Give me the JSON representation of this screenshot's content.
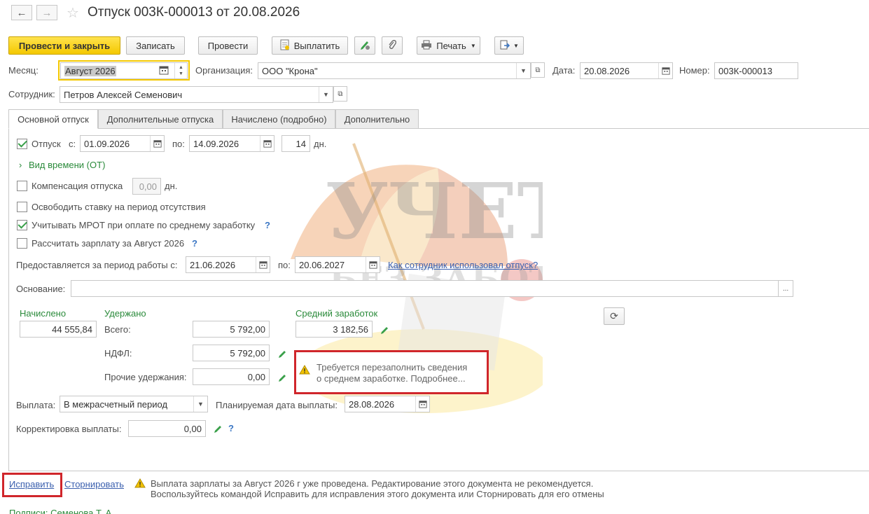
{
  "header": {
    "title": "Отпуск 003К-000013 от 20.08.2026",
    "back_icon": "arrow-left-icon",
    "forward_icon": "arrow-right-icon",
    "favorite_icon": "star-icon"
  },
  "toolbar": {
    "post_close": "Провести и закрыть",
    "save": "Записать",
    "post": "Провести",
    "pay": "Выплатить",
    "print": "Печать"
  },
  "form": {
    "month_label": "Месяц:",
    "month_value": "Август 2026",
    "org_label": "Организация:",
    "org_value": "ООО \"Крона\"",
    "date_label": "Дата:",
    "date_value": "20.08.2026",
    "number_label": "Номер:",
    "number_value": "003К-000013",
    "employee_label": "Сотрудник:",
    "employee_value": "Петров Алексей Семенович"
  },
  "tabs": [
    {
      "label": "Основной отпуск",
      "active": true
    },
    {
      "label": "Дополнительные отпуска",
      "active": false
    },
    {
      "label": "Начислено (подробно)",
      "active": false
    },
    {
      "label": "Дополнительно",
      "active": false
    }
  ],
  "main": {
    "vacation_label": "Отпуск",
    "from_label": "с:",
    "from_value": "01.09.2026",
    "to_label": "по:",
    "to_value": "14.09.2026",
    "days_value": "14",
    "days_unit": "дн.",
    "time_type": "Вид времени (ОТ)",
    "compensation_label": "Компенсация отпуска",
    "compensation_value": "0,00",
    "compensation_unit": "дн.",
    "free_rate_label": "Освободить ставку на период отсутствия",
    "mrot_label": "Учитывать МРОТ при оплате по среднему заработку",
    "calc_salary_label": "Рассчитать зарплату за Август 2026",
    "help_mark": "?",
    "period_label": "Предоставляется за период работы с:",
    "period_from": "21.06.2026",
    "period_to_label": "по:",
    "period_to": "20.06.2027",
    "period_link": "Как сотрудник использовал отпуск?",
    "basis_label": "Основание:",
    "basis_btn": "...",
    "accrued_label": "Начислено",
    "accrued_value": "44 555,84",
    "withheld_label": "Удержано",
    "total_label": "Всего:",
    "total_value": "5 792,00",
    "ndfl_label": "НДФЛ:",
    "ndfl_value": "5 792,00",
    "other_label": "Прочие удержания:",
    "other_value": "0,00",
    "avg_label": "Средний заработок",
    "avg_value": "3 182,56",
    "warning_text_1": "Требуется перезаполнить сведения",
    "warning_text_2": "о среднем заработке. Подробнее...",
    "payout_label": "Выплата:",
    "payout_value": "В межрасчетный период",
    "plan_date_label": "Планируемая дата выплаты:",
    "plan_date_value": "28.08.2026",
    "correction_label": "Корректировка выплаты:",
    "correction_value": "0,00"
  },
  "footer": {
    "fix_link": "Исправить",
    "storno_link": "Сторнировать",
    "message_1": "Выплата зарплаты за Август 2026 г уже проведена. Редактирование этого документа не рекомендуется.",
    "message_2": "Воспользуйтесь командой Исправить для исправления этого документа или Сторнировать для его отмены",
    "signatures": "Подписи: Семенова Т. А."
  },
  "watermark": {
    "line1": "УЧЕТ",
    "line2": "БЕЗ ЗАБОТ"
  },
  "colors": {
    "primary_button": "#f4c800",
    "green_text": "#2a8a3a",
    "highlight_frame": "#d0262b",
    "link": "#3a5fae"
  }
}
